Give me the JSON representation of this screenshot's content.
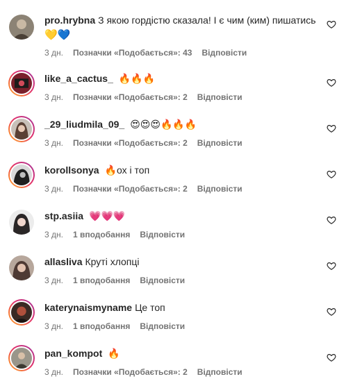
{
  "comments": [
    {
      "user": "pro.hrybna",
      "text": "З якою гордістю сказала! І є чим (ким) пишатись",
      "emoji_line": "💛💙",
      "time": "3 дн.",
      "likes": "Позначки «Подобається»: 43",
      "reply": "Відповісти",
      "story_ring": false,
      "avatar_color": "#8c8375"
    },
    {
      "user": "like_a_cactus_",
      "text": "🔥🔥🔥",
      "time": "3 дн.",
      "likes": "Позначки «Подобається»: 2",
      "reply": "Відповісти",
      "story_ring": true,
      "avatar_color": "#7a1f2b"
    },
    {
      "user": "_29_liudmila_09_",
      "text": "😍😍😍🔥🔥🔥",
      "time": "3 дн.",
      "likes": "Позначки «Подобається»: 2",
      "reply": "Відповісти",
      "story_ring": true,
      "avatar_color": "#9a8e84"
    },
    {
      "user": "korollsonya",
      "text": "🔥ох і топ",
      "time": "3 дн.",
      "likes": "Позначки «Подобається»: 2",
      "reply": "Відповісти",
      "story_ring": true,
      "avatar_color": "#2b2b2b"
    },
    {
      "user": "stp.asiia",
      "text": "💗💗💗",
      "time": "3 дн.",
      "likes": "1 вподобання",
      "reply": "Відповісти",
      "story_ring": false,
      "avatar_color": "#3a3636"
    },
    {
      "user": "allasliva",
      "text": "Круті хлопці",
      "time": "3 дн.",
      "likes": "1 вподобання",
      "reply": "Відповісти",
      "story_ring": false,
      "avatar_color": "#7a5a50"
    },
    {
      "user": "katerynaismyname",
      "text": "Це топ",
      "time": "3 дн.",
      "likes": "1 вподобання",
      "reply": "Відповісти",
      "story_ring": true,
      "avatar_color": "#6b2a22"
    },
    {
      "user": "pan_kompot",
      "text": "🔥",
      "time": "3 дн.",
      "likes": "Позначки «Подобається»: 2",
      "reply": "Відповісти",
      "story_ring": true,
      "avatar_color": "#6e6a5e"
    }
  ],
  "icons": {
    "like": "heart-outline-icon"
  }
}
